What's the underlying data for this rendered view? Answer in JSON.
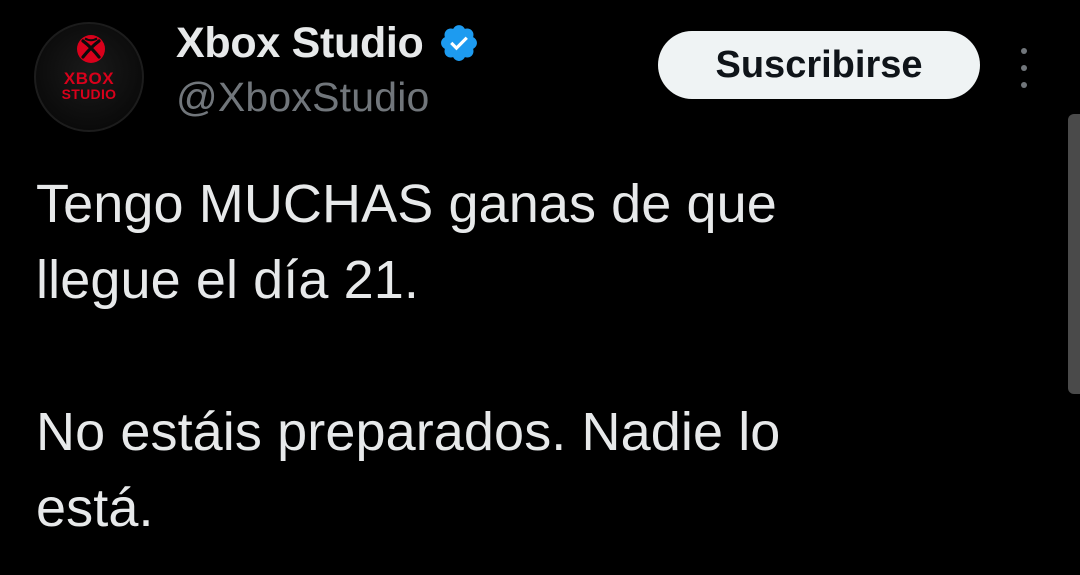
{
  "tweet": {
    "avatar": {
      "logo_line1": "XBOX",
      "logo_line2": "STUDIO",
      "icon": "xbox-logo-icon",
      "accent_color": "#d9001b"
    },
    "author": {
      "display_name": "Xbox Studio",
      "handle": "@XboxStudio",
      "verified_icon": "verified-badge-icon",
      "verified_color": "#1d9bf0"
    },
    "actions": {
      "subscribe_label": "Suscribirse",
      "more_icon": "more-vertical-icon"
    },
    "body": {
      "paragraph1_line1": "Tengo MUCHAS ganas de que",
      "paragraph1_line2": "llegue el día 21.",
      "paragraph2_line1": "No estáis preparados. Nadie lo",
      "paragraph2_line2": "está."
    }
  }
}
